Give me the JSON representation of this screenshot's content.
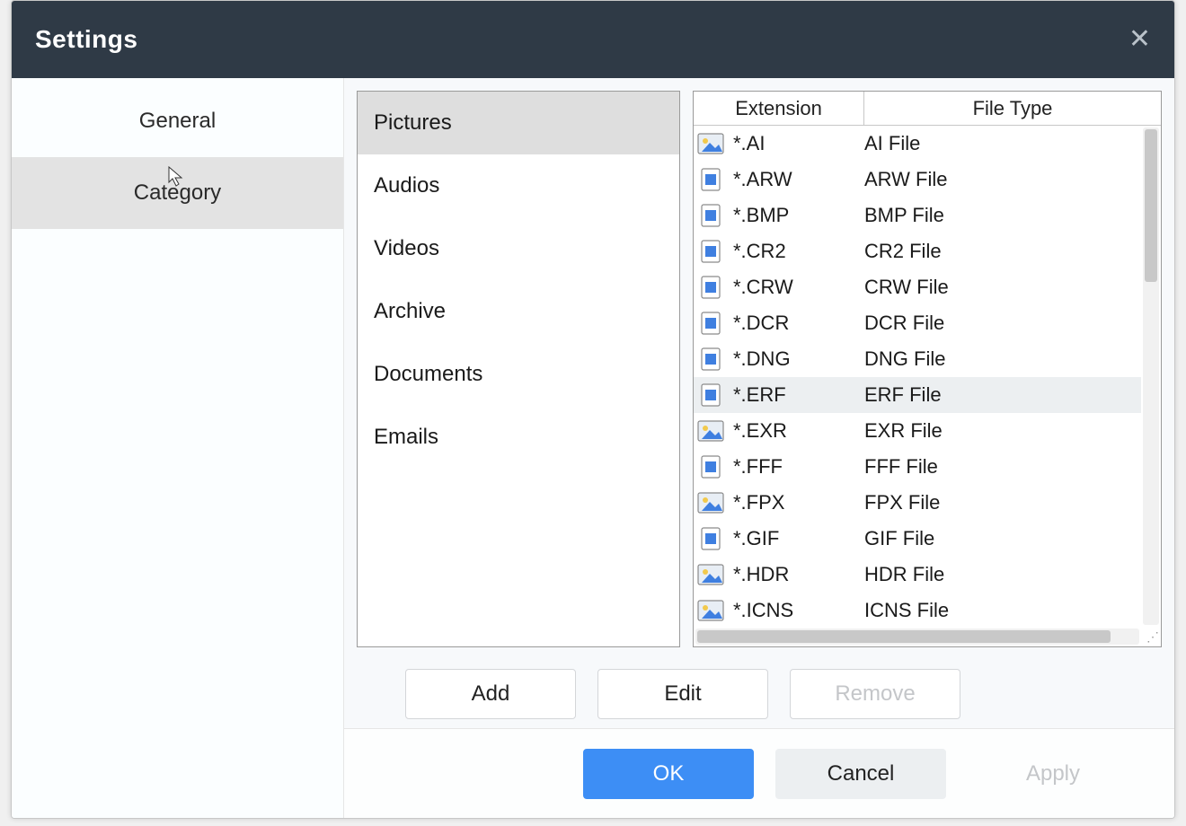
{
  "dialog": {
    "title": "Settings"
  },
  "sidebar": {
    "items": [
      {
        "label": "General",
        "selected": false
      },
      {
        "label": "Category",
        "selected": true
      }
    ]
  },
  "categories": {
    "items": [
      {
        "label": "Pictures",
        "selected": true
      },
      {
        "label": "Audios",
        "selected": false
      },
      {
        "label": "Videos",
        "selected": false
      },
      {
        "label": "Archive",
        "selected": false
      },
      {
        "label": "Documents",
        "selected": false
      },
      {
        "label": "Emails",
        "selected": false
      }
    ]
  },
  "ext_table": {
    "headers": {
      "extension": "Extension",
      "filetype": "File Type"
    },
    "rows": [
      {
        "ext": "*.AI",
        "type": "AI File",
        "icon": "img",
        "selected": false
      },
      {
        "ext": "*.ARW",
        "type": "ARW File",
        "icon": "page",
        "selected": false
      },
      {
        "ext": "*.BMP",
        "type": "BMP File",
        "icon": "page",
        "selected": false
      },
      {
        "ext": "*.CR2",
        "type": "CR2 File",
        "icon": "page",
        "selected": false
      },
      {
        "ext": "*.CRW",
        "type": "CRW File",
        "icon": "page",
        "selected": false
      },
      {
        "ext": "*.DCR",
        "type": "DCR File",
        "icon": "page",
        "selected": false
      },
      {
        "ext": "*.DNG",
        "type": "DNG File",
        "icon": "page",
        "selected": false
      },
      {
        "ext": "*.ERF",
        "type": "ERF File",
        "icon": "page",
        "selected": true
      },
      {
        "ext": "*.EXR",
        "type": "EXR File",
        "icon": "img",
        "selected": false
      },
      {
        "ext": "*.FFF",
        "type": "FFF File",
        "icon": "page",
        "selected": false
      },
      {
        "ext": "*.FPX",
        "type": "FPX File",
        "icon": "img",
        "selected": false
      },
      {
        "ext": "*.GIF",
        "type": "GIF File",
        "icon": "page",
        "selected": false
      },
      {
        "ext": "*.HDR",
        "type": "HDR File",
        "icon": "img",
        "selected": false
      },
      {
        "ext": "*.ICNS",
        "type": "ICNS File",
        "icon": "img",
        "selected": false
      }
    ]
  },
  "actions": {
    "add": {
      "label": "Add",
      "enabled": true
    },
    "edit": {
      "label": "Edit",
      "enabled": true
    },
    "remove": {
      "label": "Remove",
      "enabled": false
    }
  },
  "footer": {
    "ok": {
      "label": "OK",
      "enabled": true
    },
    "cancel": {
      "label": "Cancel",
      "enabled": true
    },
    "apply": {
      "label": "Apply",
      "enabled": false
    }
  }
}
